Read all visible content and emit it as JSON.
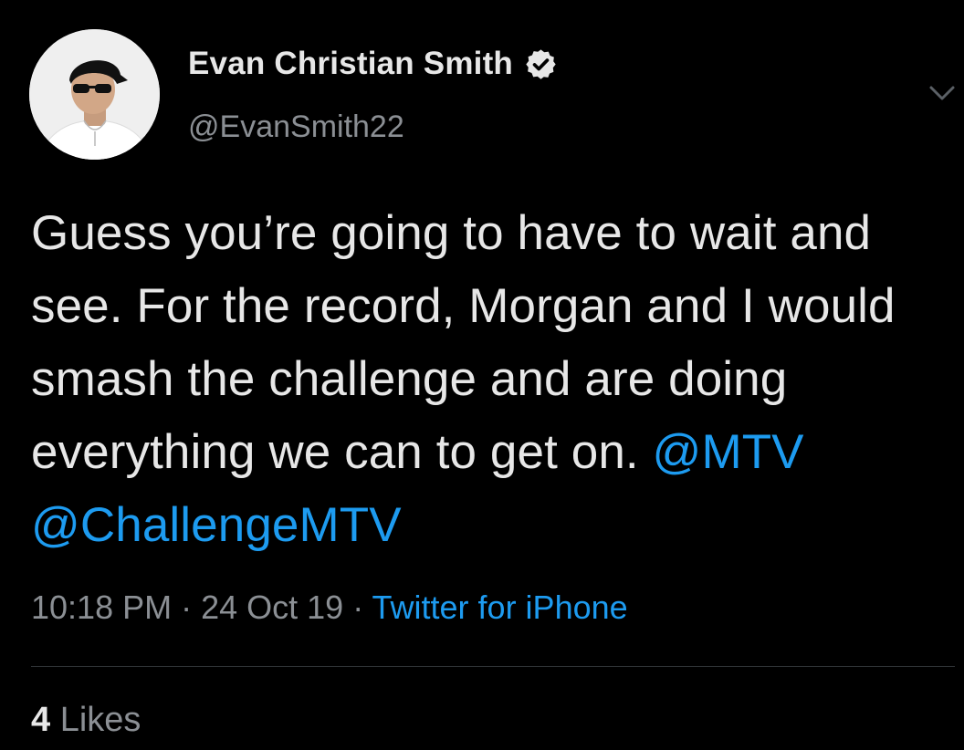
{
  "author": {
    "display_name": "Evan Christian Smith",
    "handle": "@EvanSmith22",
    "verified": true,
    "avatar_icon": "profile-photo"
  },
  "tweet": {
    "text_before": "Guess you’re going to have to wait and see. For the record, Morgan and I would smash the challenge and are doing everything we can to get on. ",
    "mentions": [
      "@MTV",
      "@ChallengeMTV"
    ]
  },
  "meta": {
    "time": "10:18 PM",
    "separator": " · ",
    "date": "24 Oct 19",
    "source": "Twitter for iPhone"
  },
  "stats": {
    "likes_count": "4",
    "likes_label": "Likes"
  },
  "colors": {
    "background": "#000000",
    "text": "#e7e7e7",
    "muted": "#8b8f94",
    "link": "#1d9bf0",
    "divider": "#2f3336"
  },
  "icons": {
    "verified": "verified-badge-icon",
    "menu": "chevron-down-icon"
  }
}
